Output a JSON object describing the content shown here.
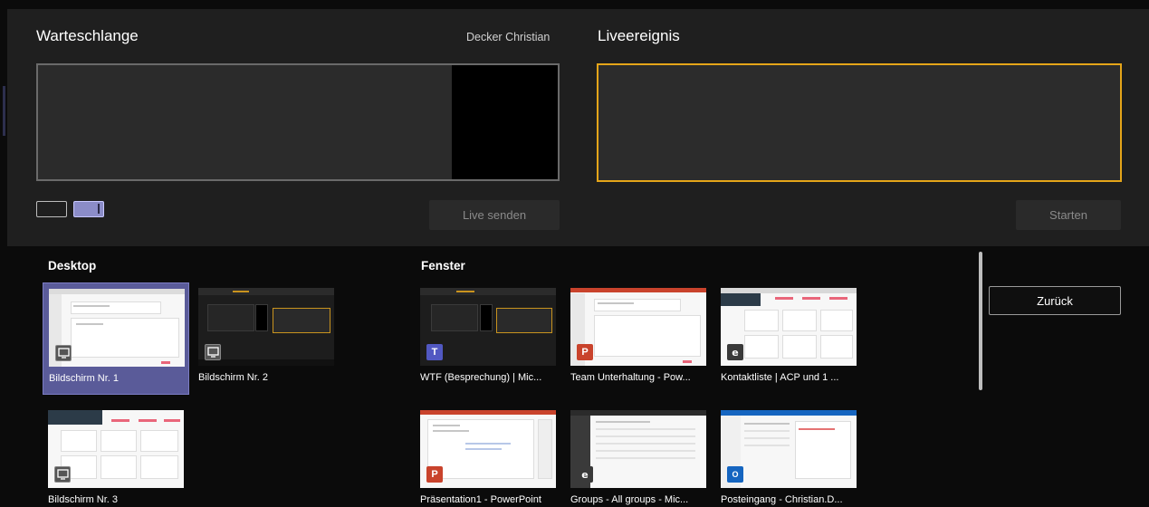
{
  "queue": {
    "title": "Warteschlange",
    "presenter": "Decker Christian",
    "live_send_label": "Live senden"
  },
  "live": {
    "title": "Liveereignis",
    "start_label": "Starten",
    "border_color": "#e5a519"
  },
  "layouts": [
    {
      "icon": "single-layout-icon"
    },
    {
      "icon": "split-layout-icon",
      "selected": true
    }
  ],
  "desktop": {
    "title": "Desktop",
    "items": [
      {
        "label": "Bildschirm Nr. 1",
        "icon": "monitor-icon",
        "selected": true
      },
      {
        "label": "Bildschirm Nr. 2",
        "icon": "monitor-icon"
      },
      {
        "label": "Bildschirm Nr. 3",
        "icon": "monitor-icon"
      }
    ]
  },
  "windows": {
    "title": "Fenster",
    "items": [
      {
        "label": "WTF (Besprechung) | Mic...",
        "icon": "teams-icon",
        "badge": "T"
      },
      {
        "label": "Team Unterhaltung - Pow...",
        "icon": "powerpoint-icon",
        "badge": "P"
      },
      {
        "label": "Kontaktliste | ACP und 1 ...",
        "icon": "edge-icon",
        "badge": "e"
      },
      {
        "label": "Präsentation1 - PowerPoint",
        "icon": "powerpoint-icon",
        "badge": "P"
      },
      {
        "label": "Groups - All groups - Mic...",
        "icon": "edge-icon",
        "badge": "e"
      },
      {
        "label": "Posteingang - Christian.D...",
        "icon": "outlook-icon",
        "badge": "O"
      }
    ]
  },
  "back_label": "Zurück",
  "colors": {
    "accent": "#5a5b99",
    "live_border": "#e5a519",
    "background": "#0b0b0b",
    "panel": "#1f1f1f"
  }
}
